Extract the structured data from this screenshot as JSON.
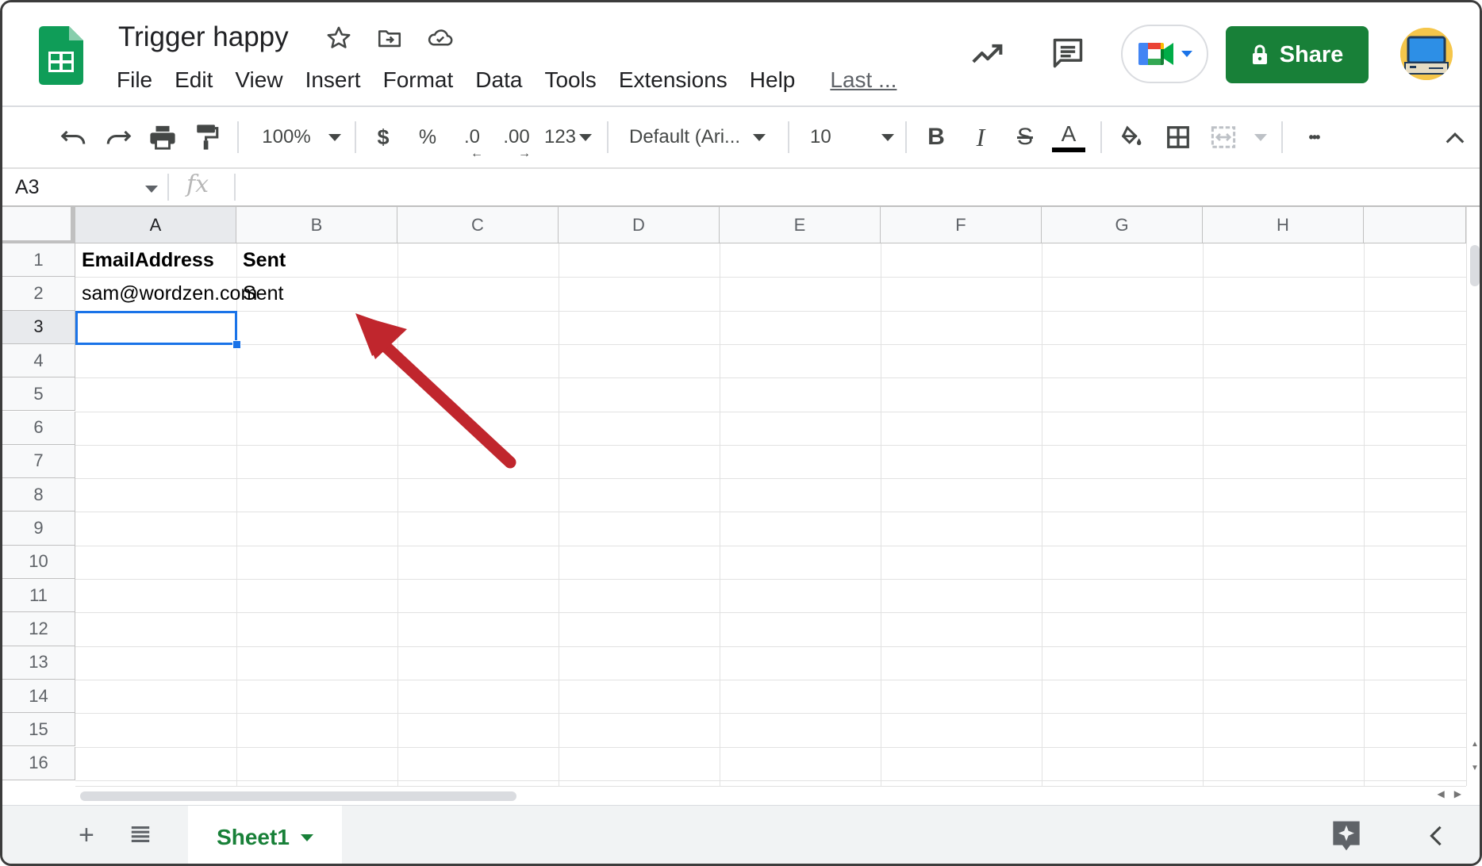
{
  "app": {
    "doc_title": "Trigger happy",
    "share_label": "Share"
  },
  "menu": {
    "items": [
      "File",
      "Edit",
      "View",
      "Insert",
      "Format",
      "Data",
      "Tools",
      "Extensions",
      "Help"
    ],
    "last_edit": "Last ..."
  },
  "toolbar": {
    "zoom": "100%",
    "currency": "$",
    "percent": "%",
    "decrease_decimal": ".0",
    "increase_decimal": ".00",
    "more_formats": "123",
    "font": "Default (Ari...",
    "font_size": "10",
    "bold": "B",
    "italic": "I",
    "strikethrough": "S",
    "text_color": "A",
    "more": "•••"
  },
  "formula_bar": {
    "name_box": "A3",
    "fx": "fx",
    "content": ""
  },
  "grid": {
    "columns": [
      "A",
      "B",
      "C",
      "D",
      "E",
      "F",
      "G",
      "H"
    ],
    "rows": [
      "1",
      "2",
      "3",
      "4",
      "5",
      "6",
      "7",
      "8",
      "9",
      "10",
      "11",
      "12",
      "13",
      "14",
      "15",
      "16"
    ],
    "selected_cell": "A3",
    "cells": {
      "A1": "EmailAddress",
      "B1": "Sent",
      "A2": "sam@wordzen.com",
      "B2": "Sent"
    }
  },
  "sheets": {
    "tabs": [
      {
        "label": "Sheet1",
        "active": true
      }
    ]
  },
  "colors": {
    "brand_green": "#188038",
    "selection_blue": "#1a73e8",
    "annotation_arrow": "#c0262d"
  }
}
